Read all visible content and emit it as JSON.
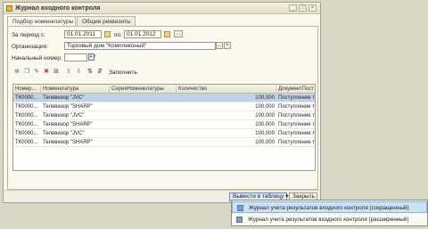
{
  "window": {
    "title": "Журнал входного контроля",
    "buttons": [
      "_",
      "□",
      "×"
    ]
  },
  "tabs": [
    {
      "label": "Подбор номенклатуры",
      "active": true
    },
    {
      "label": "Общие реквизиты",
      "active": false
    }
  ],
  "form": {
    "period_label": "За период с:",
    "date_from": "01.01.2011",
    "date_to_label": "по:",
    "date_to": "01.01.2012",
    "period_button": "...",
    "org_label": "Организация:",
    "org_value": "Торговый дом \"Комплексный\"",
    "org_select": "...",
    "org_clear": "×",
    "start_number_label": "Начальный номер:",
    "start_number_value": "",
    "start_number_stepper": "▲▼"
  },
  "toolbar": {
    "icons": [
      "add-icon",
      "copy-icon",
      "edit-icon",
      "delete-icon",
      "close-icon",
      "up-icon",
      "down-icon",
      "sort-asc-icon",
      "sort-desc-icon"
    ],
    "fill_label": "Заполнить"
  },
  "table": {
    "columns": [
      "Номер...",
      "Номенклатура",
      "СерияНоменклатуры",
      "Количество",
      "ДокументПост"
    ],
    "rows": [
      [
        "ТК0000...",
        "Телевизор \"JVC\"",
        "",
        "100,000",
        "Поступление то"
      ],
      [
        "ТК0000...",
        "Телевизор \"SHARP\"",
        "",
        "100,000",
        "Поступление то"
      ],
      [
        "ТК0000...",
        "Телевизор \"JVC\"",
        "",
        "100,000",
        "Поступление то"
      ],
      [
        "ТК0000...",
        "Телевизор \"SHARP\"",
        "",
        "100,000",
        "Поступление то"
      ],
      [
        "ТК0000...",
        "Телевизор \"JVC\"",
        "",
        "100,000",
        "Поступление то"
      ],
      [
        "ТК0000...",
        "Телевизор \"SHARP\"",
        "",
        "100,000",
        "Поступление то"
      ]
    ],
    "selected_row": 0
  },
  "bottom": {
    "export_button": "Вывести в таблицу",
    "export_arrow": "▾",
    "close_button": "Закрыть"
  },
  "menu": {
    "items": [
      "Журнал учета результатов входного контроля (сокращенный)",
      "Журнал учета результатов входного контроля (расширенный)"
    ],
    "highlighted": 0
  }
}
